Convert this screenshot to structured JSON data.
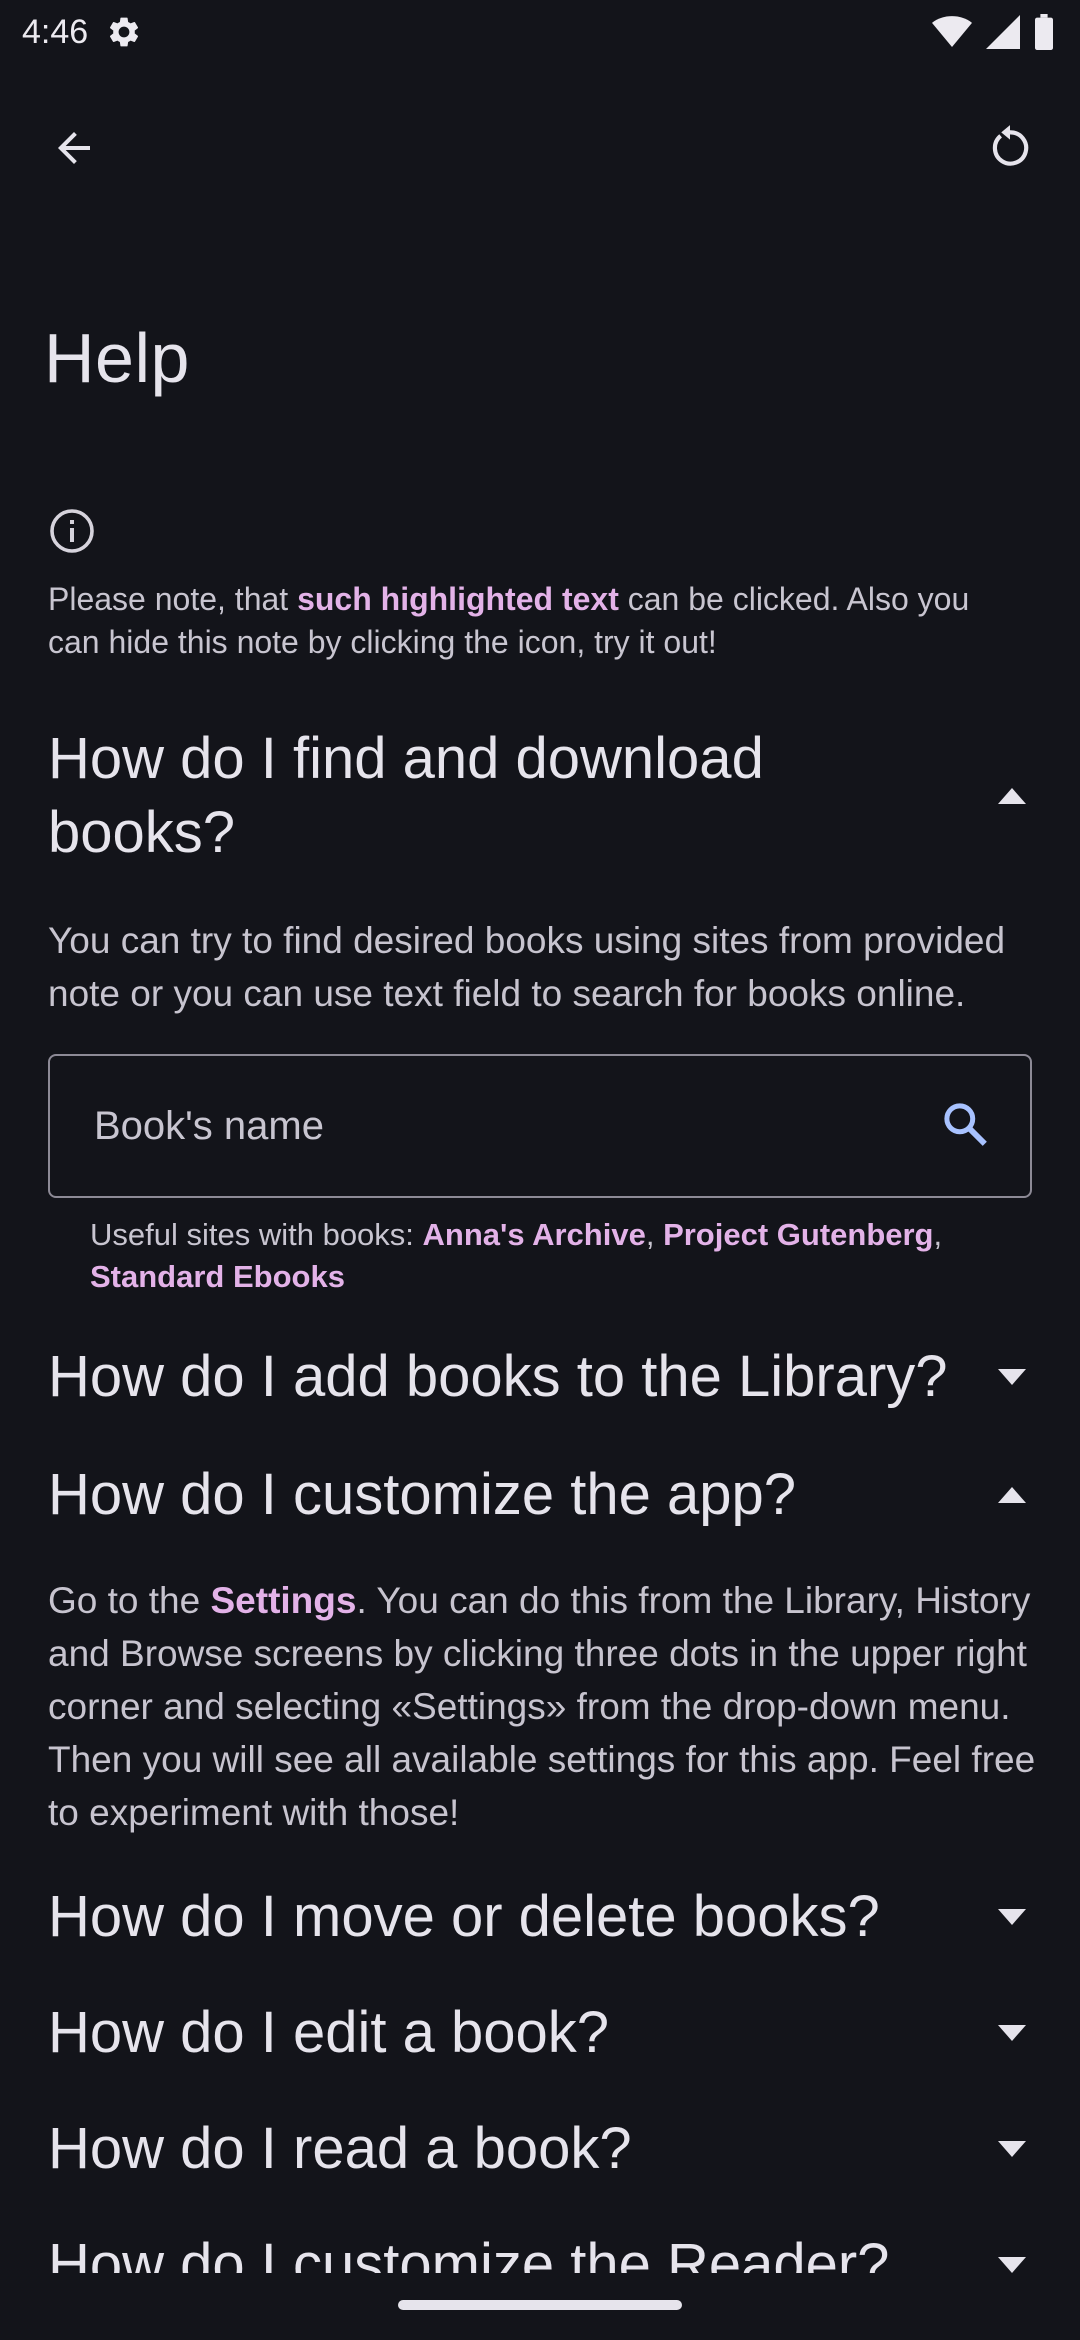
{
  "status_bar": {
    "time": "4:46"
  },
  "page": {
    "title": "Help"
  },
  "note": {
    "before": "Please note, that ",
    "highlight": "such highlighted text",
    "after": " can be clicked. Also you can hide this note by clicking the icon, try it out!"
  },
  "faq": [
    {
      "question": "How do I find and download books?",
      "expanded": true,
      "answer": "You can try to find desired books using sites from provided note or you can use text field to search for books online.",
      "search_placeholder": "Book's name",
      "sites_label": "Useful sites with books: ",
      "sites": [
        "Anna's Archive",
        "Project Gutenberg",
        "Standard Ebooks"
      ],
      "sites_separator": ", "
    },
    {
      "question": "How do I add books to the Library?",
      "expanded": false
    },
    {
      "question": "How do I customize the app?",
      "expanded": true,
      "answer_before": "Go to the ",
      "answer_link": "Settings",
      "answer_after": ". You can do this from the Library, History and Browse screens by clicking three dots in the upper right corner and selecting «Settings» from the drop-down menu. Then you will see all available settings for this app. Feel free to experiment with those!"
    },
    {
      "question": "How do I move or delete books?",
      "expanded": false
    },
    {
      "question": "How do I edit a book?",
      "expanded": false
    },
    {
      "question": "How do I read a book?",
      "expanded": false
    },
    {
      "question": "How do I customize the Reader?",
      "expanded": false
    }
  ],
  "colors": {
    "background": "#13141a",
    "link": "#e3b2e8",
    "search_icon": "#a8c2ff"
  }
}
